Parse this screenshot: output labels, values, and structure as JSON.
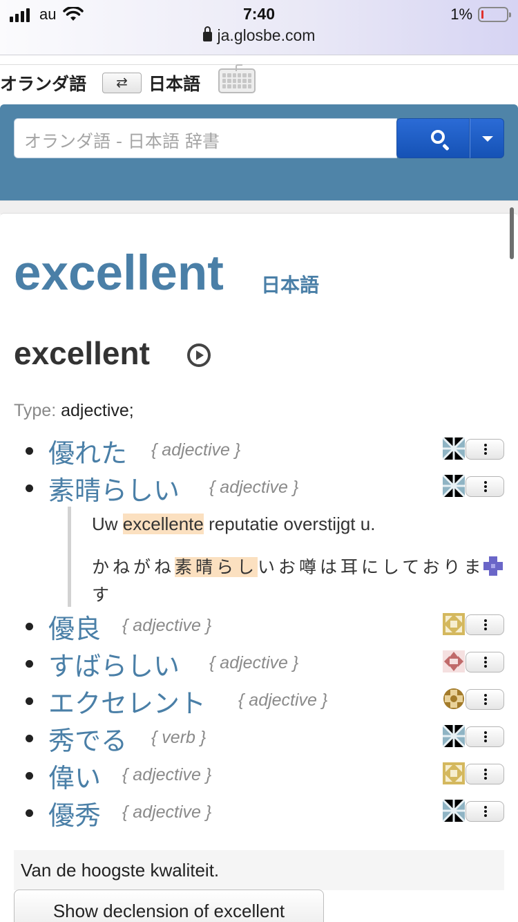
{
  "status": {
    "carrier": "au",
    "time": "7:40",
    "battery_pct": "1%",
    "url": "ja.glosbe.com"
  },
  "langbar": {
    "source": "オランダ語",
    "target": "日本語",
    "swap": "⇄"
  },
  "search": {
    "placeholder": "オランダ語 - 日本語 辞書"
  },
  "headword": {
    "word": "excellent",
    "lang": "日本語"
  },
  "entry_word": "excellent",
  "type_label": "Type:",
  "type_value": "adjective;",
  "translations": [
    {
      "term": "優れた",
      "pos": "{ adjective }"
    },
    {
      "term": "素晴らしい",
      "pos": "{ adjective }"
    },
    {
      "term": "優良",
      "pos": "{ adjective }"
    },
    {
      "term": "すばらしい",
      "pos": "{ adjective }"
    },
    {
      "term": "エクセレント",
      "pos": "{ adjective }"
    },
    {
      "term": "秀でる",
      "pos": "{ verb }"
    },
    {
      "term": "偉い",
      "pos": "{ adjective }"
    },
    {
      "term": "優秀",
      "pos": "{ adjective }"
    }
  ],
  "example": {
    "src_before": "Uw ",
    "src_highlight": "excellente",
    "src_after": " reputatie overstijgt u.",
    "tgt_before": "かねがね",
    "tgt_highlight": "素晴らし",
    "tgt_after": "いお噂は耳にしております"
  },
  "definition": "Van de hoogste kwaliteit.",
  "declension_button": "Show declension of excellent",
  "colors": {
    "accent": "#4a7fa7",
    "band": "#4f84a8",
    "button": "#1f5fc8"
  }
}
